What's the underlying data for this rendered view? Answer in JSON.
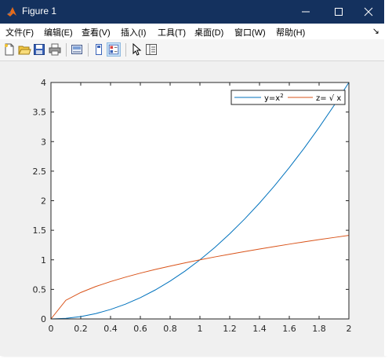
{
  "window": {
    "title": "Figure 1",
    "controls": {
      "minimize": "minimize",
      "maximize": "maximize",
      "close": "close"
    }
  },
  "menu": {
    "items": [
      "文件(F)",
      "编辑(E)",
      "查看(V)",
      "插入(I)",
      "工具(T)",
      "桌面(D)",
      "窗口(W)",
      "帮助(H)"
    ],
    "overflow_glyph": "↘"
  },
  "toolbar": {
    "icons": [
      "new-figure-icon",
      "open-file-icon",
      "save-icon",
      "print-icon",
      "link-plot-icon",
      "hide-plot-tools-icon",
      "show-plot-tools-icon",
      "edit-plot-arrow-icon",
      "property-inspector-icon"
    ]
  },
  "colors": {
    "series1": "#0072bd",
    "series2": "#d95319",
    "titlebar": "#14315e"
  },
  "chart_data": {
    "type": "line",
    "xlim": [
      0,
      2
    ],
    "ylim": [
      0,
      4
    ],
    "x_ticks": [
      "0",
      "0.2",
      "0.4",
      "0.6",
      "0.8",
      "1",
      "1.2",
      "1.4",
      "1.6",
      "1.8",
      "2"
    ],
    "y_ticks": [
      "0",
      "0.5",
      "1",
      "1.5",
      "2",
      "2.5",
      "3",
      "3.5",
      "4"
    ],
    "x": [
      0,
      0.1,
      0.2,
      0.3,
      0.4,
      0.5,
      0.6,
      0.7,
      0.8,
      0.9,
      1.0,
      1.1,
      1.2,
      1.3,
      1.4,
      1.5,
      1.6,
      1.7,
      1.8,
      1.9,
      2.0
    ],
    "series": [
      {
        "name": "y=x²",
        "legend_base": "y=x",
        "legend_sup": "2",
        "color": "#0072bd",
        "values": [
          0,
          0.01,
          0.04,
          0.09,
          0.16,
          0.25,
          0.36,
          0.49,
          0.64,
          0.81,
          1.0,
          1.21,
          1.44,
          1.69,
          1.96,
          2.25,
          2.56,
          2.89,
          3.24,
          3.61,
          4.0
        ]
      },
      {
        "name": "z= √ x",
        "color": "#d95319",
        "values": [
          0,
          0.316,
          0.447,
          0.548,
          0.632,
          0.707,
          0.775,
          0.837,
          0.894,
          0.949,
          1.0,
          1.049,
          1.095,
          1.14,
          1.183,
          1.225,
          1.265,
          1.304,
          1.342,
          1.378,
          1.414
        ]
      }
    ],
    "legend": "top-right",
    "grid": false
  }
}
